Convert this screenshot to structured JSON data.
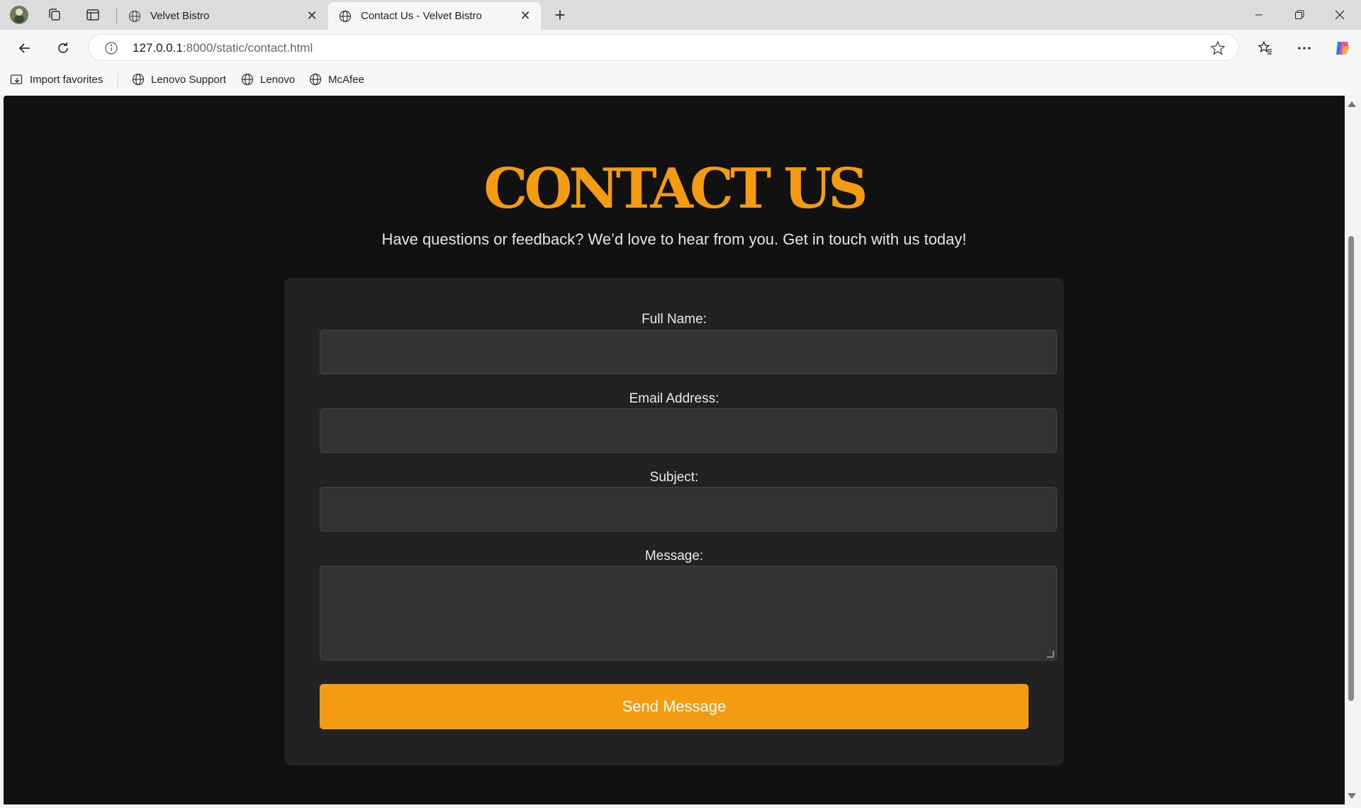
{
  "browser": {
    "tabs": [
      {
        "title": "Velvet Bistro",
        "active": false
      },
      {
        "title": "Contact Us - Velvet Bistro",
        "active": true
      }
    ],
    "address": {
      "host": "127.0.0.1",
      "path": ":8000/static/contact.html"
    },
    "favorites": [
      "Import favorites",
      "Lenovo Support",
      "Lenovo",
      "McAfee"
    ]
  },
  "page": {
    "title": "CONTACT US",
    "subtitle": "Have questions or feedback? We’d love to hear from you. Get in touch with us today!",
    "form": {
      "full_name_label": "Full Name:",
      "full_name_value": "",
      "email_label": "Email Address:",
      "email_value": "",
      "subject_label": "Subject:",
      "subject_value": "",
      "message_label": "Message:",
      "message_value": "",
      "submit_label": "Send Message"
    }
  },
  "colors": {
    "accent": "#f39c12",
    "page_background": "#111111",
    "card_background": "#222222",
    "input_background": "#333333"
  }
}
